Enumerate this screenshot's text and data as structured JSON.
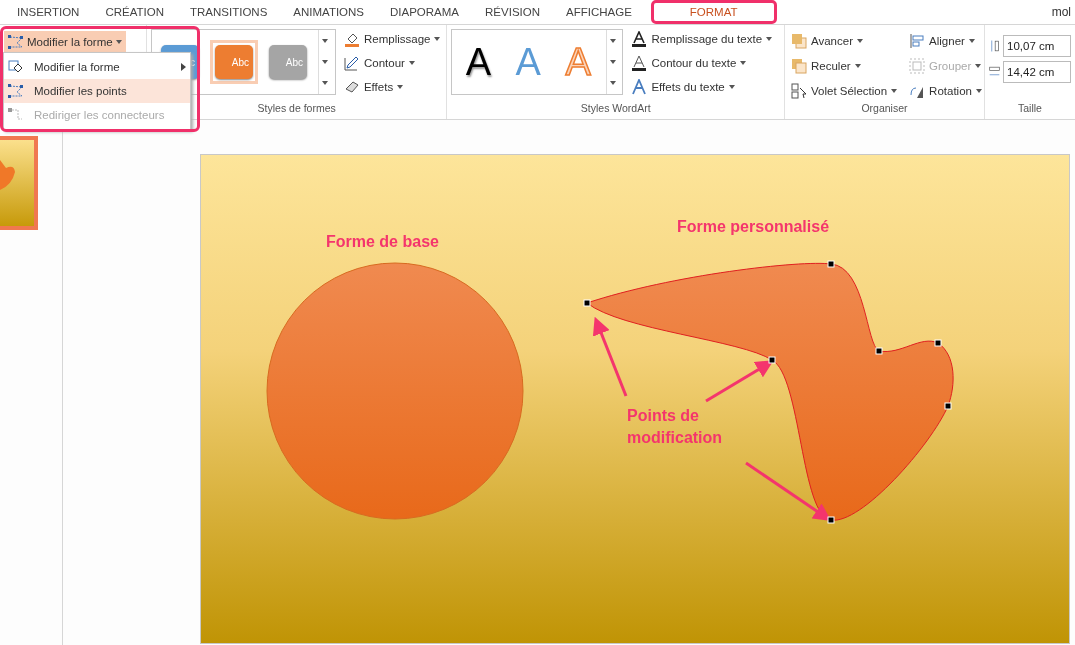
{
  "tabs": [
    {
      "label": "INSERTION",
      "selected": false
    },
    {
      "label": "CRÉATION",
      "selected": false
    },
    {
      "label": "TRANSITIONS",
      "selected": false
    },
    {
      "label": "ANIMATIONS",
      "selected": false
    },
    {
      "label": "DIAPORAMA",
      "selected": false
    },
    {
      "label": "RÉVISION",
      "selected": false
    },
    {
      "label": "AFFICHAGE",
      "selected": false
    },
    {
      "label": "FORMAT",
      "selected": true
    }
  ],
  "user": "mol",
  "edit_shape_button": "Modifier la forme",
  "shape_styles": {
    "label": "Styles de formes",
    "presets": [
      {
        "text": "c",
        "color": "#5b9bd5",
        "selected": false
      },
      {
        "text": "Abc",
        "color": "#ed7d31",
        "selected": true
      },
      {
        "text": "Abc",
        "color": "#a5a5a5",
        "selected": false
      }
    ],
    "commands": [
      {
        "label": "Remplissage",
        "kind": "fill"
      },
      {
        "label": "Contour",
        "kind": "outline"
      },
      {
        "label": "Effets",
        "kind": "effects"
      }
    ]
  },
  "wordart": {
    "label": "Styles WordArt",
    "letters": [
      {
        "text": "A",
        "kind": "black"
      },
      {
        "text": "A",
        "kind": "blue"
      },
      {
        "text": "A",
        "kind": "outline"
      }
    ],
    "commands": [
      {
        "label": "Remplissage du texte",
        "kind": "fill"
      },
      {
        "label": "Contour du texte",
        "kind": "outline"
      },
      {
        "label": "Effets du texte",
        "kind": "effects"
      }
    ]
  },
  "arrange": {
    "label": "Organiser",
    "items": [
      {
        "label": "Avancer",
        "kind": "forward",
        "disabled": false
      },
      {
        "label": "Reculer",
        "kind": "backward",
        "disabled": false
      },
      {
        "label": "Volet Sélection",
        "kind": "pane",
        "disabled": false
      },
      {
        "label": "Aligner",
        "kind": "align",
        "disabled": false
      },
      {
        "label": "Grouper",
        "kind": "group",
        "disabled": true
      },
      {
        "label": "Rotation",
        "kind": "rotate",
        "disabled": false
      }
    ]
  },
  "size": {
    "label": "Taille",
    "height": "10,07 cm",
    "width": "14,42 cm"
  },
  "menu": [
    {
      "label": "Modifier la forme",
      "kind": "shape",
      "submenu": true,
      "selected": false,
      "disabled": false
    },
    {
      "label": "Modifier les points",
      "kind": "points",
      "submenu": false,
      "selected": true,
      "disabled": false
    },
    {
      "label": "Rediriger les connecteurs",
      "kind": "connectors",
      "submenu": false,
      "selected": false,
      "disabled": true
    }
  ],
  "slide": {
    "base_label": "Forme de base",
    "custom_label": "Forme personnalisé",
    "points_label": "Points de modification"
  }
}
